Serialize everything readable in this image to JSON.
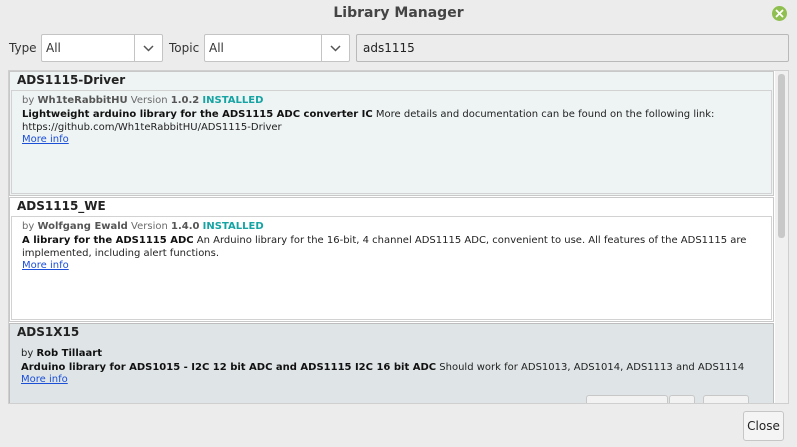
{
  "window": {
    "title": "Library Manager"
  },
  "filters": {
    "type_label": "Type",
    "type_value": "All",
    "topic_label": "Topic",
    "topic_value": "All",
    "search_value": "ads1115"
  },
  "libraries": [
    {
      "name": "ADS1115-Driver",
      "by": "by",
      "author": "Wh1teRabbitHU",
      "version_label": "Version",
      "version": "1.0.2",
      "status": "INSTALLED",
      "summary": "Lightweight arduino library for the ADS1115 ADC converter IC",
      "description": "More details and documentation can be found on the following link: https://github.com/Wh1teRabbitHU/ADS1115-Driver",
      "more_info": "More info"
    },
    {
      "name": "ADS1115_WE",
      "by": "by",
      "author": "Wolfgang Ewald",
      "version_label": "Version",
      "version": "1.4.0",
      "status": "INSTALLED",
      "summary": "A library for the ADS1115 ADC",
      "description": "An Arduino library for the 16-bit, 4 channel ADS1115 ADC, convenient to use. All features of the ADS1115 are implemented, including alert functions.",
      "more_info": "More info"
    },
    {
      "name": "ADS1X15",
      "by": "by",
      "author": "Rob Tillaart",
      "summary": "Arduino library for ADS1015 - I2C 12 bit ADC and ADS1115 I2C 16 bit ADC",
      "description": "Should work for ADS1013, ADS1014, ADS1113 and ADS1114",
      "more_info": "More info"
    }
  ],
  "footer": {
    "close_label": "Close"
  },
  "colors": {
    "installed": "#16a3a3",
    "link": "#1b4fd8",
    "selected_bg": "#dfe5e7",
    "installed_bg": "#eef3f3"
  }
}
